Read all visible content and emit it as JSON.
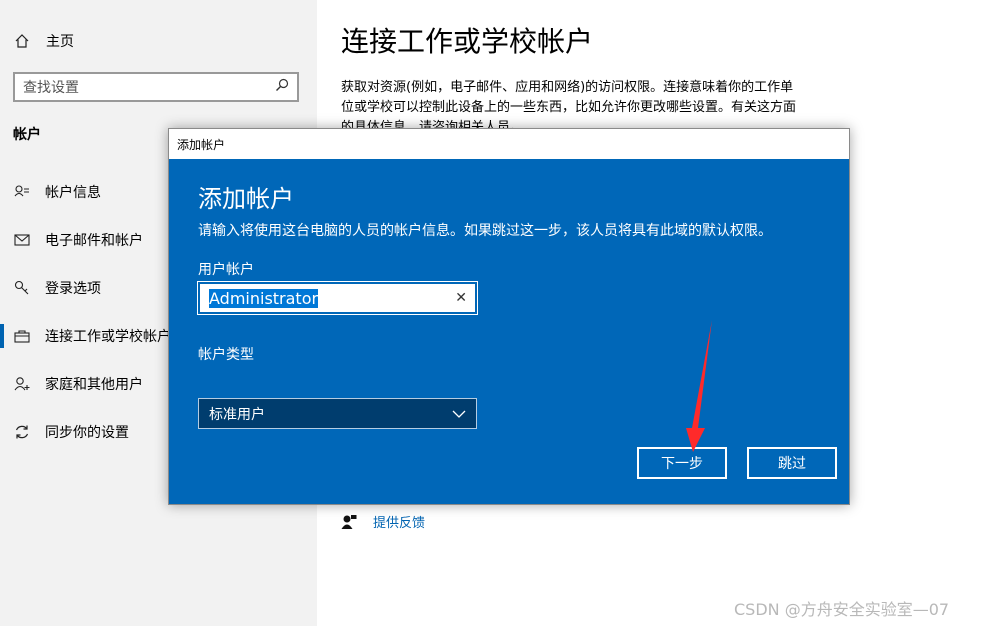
{
  "sidebar": {
    "home_label": "主页",
    "search_placeholder": "查找设置",
    "section_title": "帐户",
    "items": [
      {
        "label": "帐户信息",
        "icon": "account-info-icon"
      },
      {
        "label": "电子邮件和帐户",
        "icon": "mail-icon"
      },
      {
        "label": "登录选项",
        "icon": "key-icon"
      },
      {
        "label": "连接工作或学校帐户",
        "icon": "briefcase-icon",
        "active": true
      },
      {
        "label": "家庭和其他用户",
        "icon": "person-add-icon"
      },
      {
        "label": "同步你的设置",
        "icon": "sync-icon"
      }
    ]
  },
  "main": {
    "title": "连接工作或学校帐户",
    "description": "获取对资源(例如，电子邮件、应用和网络)的访问权限。连接意味着你的工作单位或学校可以控制此设备上的一些东西，比如允许你更改哪些设置。有关这方面的具体信息，请咨询相关人员。",
    "feedback_label": "提供反馈"
  },
  "dialog": {
    "window_title": "添加帐户",
    "heading": "添加帐户",
    "description": "请输入将使用这台电脑的人员的帐户信息。如果跳过这一步，该人员将具有此域的默认权限。",
    "user_label": "用户帐户",
    "user_value": "Administrator",
    "type_label": "帐户类型",
    "type_value": "标准用户",
    "next_button": "下一步",
    "skip_button": "跳过"
  },
  "watermark": "CSDN @方舟安全实验室—07",
  "colors": {
    "dialog_bg": "#0067b8",
    "accent": "#0063b1",
    "select_bg": "#003d6e",
    "arrow": "#ff2a2a"
  }
}
